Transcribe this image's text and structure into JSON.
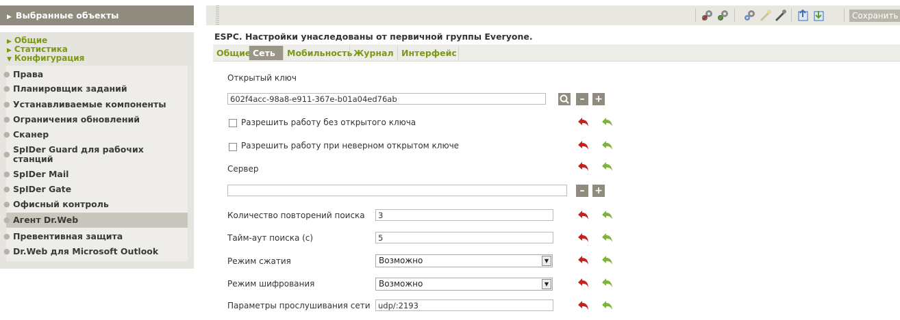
{
  "sidebar": {
    "header": "Выбранные объекты",
    "categories": [
      "Общие",
      "Статистика",
      "Конфигурация"
    ],
    "items": [
      {
        "label": "Права"
      },
      {
        "label": "Планировщик заданий"
      },
      {
        "label": "Устанавливаемые компоненты"
      },
      {
        "label": "Ограничения обновлений"
      },
      {
        "label": "Сканер"
      },
      {
        "label": "SpIDer Guard для рабочих станций"
      },
      {
        "label": "SpIDer Mail"
      },
      {
        "label": "SpIDer Gate"
      },
      {
        "label": "Офисный контроль"
      },
      {
        "label": "Агент Dr.Web",
        "active": true
      },
      {
        "label": "Превентивная защита"
      },
      {
        "label": "Dr.Web для Microsoft Outlook"
      }
    ]
  },
  "toolbar": {
    "save_label": "Сохранить",
    "icons": [
      "gears-red-icon",
      "gears-green-icon",
      "gears-config-icon",
      "wand-icon",
      "wand-dark-icon",
      "export-icon",
      "import-icon"
    ]
  },
  "page": {
    "title": "ESPC. Настройки унаследованы от первичной группы Everyone.",
    "tabs": [
      "Общие",
      "Сеть",
      "Мобильность",
      "Журнал",
      "Интерфейс"
    ],
    "active_tab": "Сеть"
  },
  "form": {
    "public_key_label": "Открытый ключ",
    "public_key_value": "602f4acc-98a8-e911-367e-b01a04ed76ab",
    "allow_no_key_label": "Разрешить работу без открытого ключа",
    "allow_no_key_checked": false,
    "allow_wrong_key_label": "Разрешить работу при неверном открытом ключе",
    "allow_wrong_key_checked": false,
    "server_label": "Сервер",
    "server_value": "",
    "retry_label": "Количество повторений поиска",
    "retry_value": "3",
    "timeout_label": "Тайм-аут поиска (с)",
    "timeout_value": "5",
    "compression_label": "Режим сжатия",
    "compression_value": "Возможно",
    "encryption_label": "Режим шифрования",
    "encryption_value": "Возможно",
    "listen_label": "Параметры прослушивания сети",
    "listen_value": "udp/:2193"
  },
  "colors": {
    "accent_green": "#7a9a16",
    "header_gray": "#8f8b7e",
    "revert_red": "#c8201c",
    "revert_green": "#7fb43a"
  }
}
